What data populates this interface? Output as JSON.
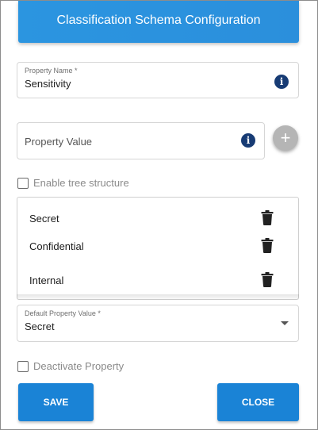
{
  "header": {
    "title": "Classification Schema Configuration"
  },
  "property_name": {
    "label": "Property Name *",
    "value": "Sensitivity",
    "info_icon": "info-icon"
  },
  "property_value": {
    "placeholder": "Property Value",
    "info_icon": "info-icon",
    "add_icon": "plus-icon"
  },
  "enable_tree": {
    "label": "Enable tree structure",
    "checked": false
  },
  "values_list": {
    "items": [
      {
        "label": "Secret",
        "delete_icon": "trash-icon"
      },
      {
        "label": "Confidential",
        "delete_icon": "trash-icon"
      },
      {
        "label": "Internal",
        "delete_icon": "trash-icon"
      }
    ]
  },
  "default_value": {
    "label": "Default Property Value *",
    "value": "Secret",
    "dropdown_icon": "chevron-down-icon"
  },
  "deactivate": {
    "label": "Deactivate Property",
    "checked": false
  },
  "buttons": {
    "save": "SAVE",
    "close": "CLOSE"
  },
  "colors": {
    "primary": "#1a83d6",
    "header": "#2b95e0",
    "info_icon": "#173b74",
    "add_button": "#b5b5b5"
  }
}
